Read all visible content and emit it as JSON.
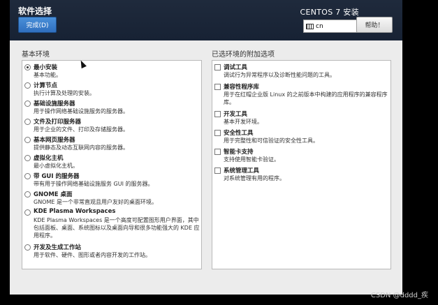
{
  "header": {
    "title": "软件选择",
    "done_button": "完成(D)",
    "product": "CENTOS 7 安装",
    "keyboard_layout": "cn",
    "help_button": "帮助！"
  },
  "left": {
    "label": "基本环境",
    "items": [
      {
        "name": "最小安装",
        "desc": "基本功能。",
        "selected": true
      },
      {
        "name": "计算节点",
        "desc": "执行计算及处理的安装。",
        "selected": false
      },
      {
        "name": "基础设施服务器",
        "desc": "用于操作网络基础设施服务的服务器。",
        "selected": false
      },
      {
        "name": "文件及打印服务器",
        "desc": "用于企业的文件、打印及存储服务器。",
        "selected": false
      },
      {
        "name": "基本网页服务器",
        "desc": "提供静态及动态互联网内容的服务器。",
        "selected": false
      },
      {
        "name": "虚拟化主机",
        "desc": "最小虚拟化主机。",
        "selected": false
      },
      {
        "name": "带 GUI 的服务器",
        "desc": "带有用于操作网络基础设施服务 GUI 的服务器。",
        "selected": false
      },
      {
        "name": "GNOME 桌面",
        "desc": "GNOME 是一个非常直观且用户友好的桌面环境。",
        "selected": false
      },
      {
        "name": "KDE Plasma Workspaces",
        "desc": "KDE Plasma Workspaces 是一个高度可配置图形用户界面，其中包括面板、桌面、系统图标以及桌面向导和很多功能强大的 KDE 应用程序。",
        "selected": false
      },
      {
        "name": "开发及生成工作站",
        "desc": "用于软件、硬件、图形或者内容开发的工作站。",
        "selected": false
      }
    ]
  },
  "right": {
    "label": "已选环境的附加选项",
    "items": [
      {
        "name": "调试工具",
        "desc": "调试行为异常程序以及诊断性能问题的工具。"
      },
      {
        "name": "兼容性程序库",
        "desc": "用于在红帽企业版 Linux 的之前版本中构建的应用程序的兼容程序库。"
      },
      {
        "name": "开发工具",
        "desc": "基本开发环境。"
      },
      {
        "name": "安全性工具",
        "desc": "用于完整性和可信验证的安全性工具。"
      },
      {
        "name": "智能卡支持",
        "desc": "支持使用智能卡验证。"
      },
      {
        "name": "系统管理工具",
        "desc": "对系统管理有用的程序。"
      }
    ]
  },
  "watermark": "CSDN @dddd_疾"
}
